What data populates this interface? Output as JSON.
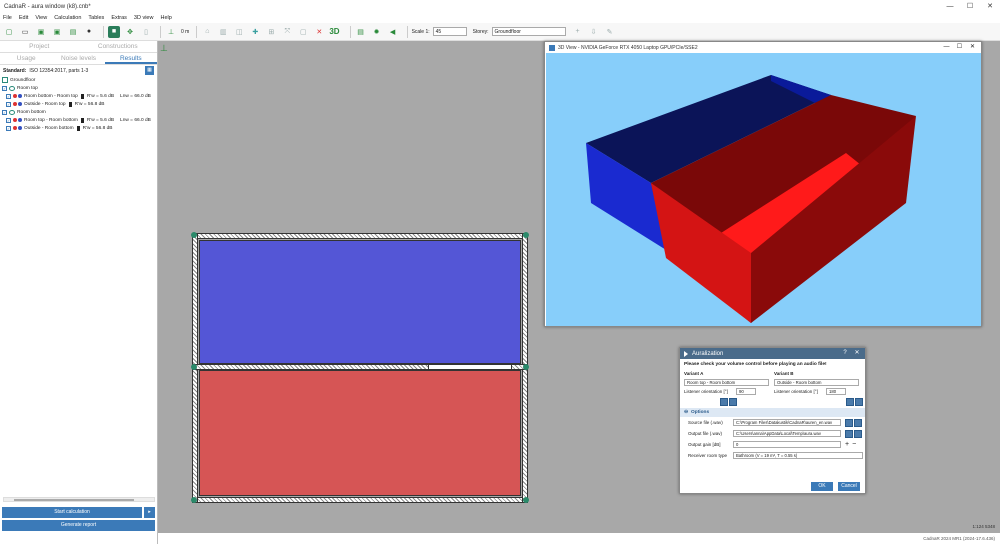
{
  "window": {
    "title": "CadnaR - aura window (k8).cnb*",
    "controls": [
      "—",
      "☐",
      "✕"
    ]
  },
  "menu": [
    "File",
    "Edit",
    "View",
    "Calculation",
    "Tables",
    "Extras",
    "3D view",
    "Help"
  ],
  "toolbar": {
    "height_value": "0 m",
    "scale_label": "Scale 1:",
    "scale_value": "45",
    "storey_label": "Storey:",
    "storey_value": "Groundfloor",
    "view3d_label": "3D"
  },
  "left_panel": {
    "tabs_top": [
      "Project",
      "Constructions"
    ],
    "tabs_bottom": [
      "Usage",
      "Noise levels",
      "Results"
    ],
    "standard_label": "Standard:",
    "standard_value": "ISO 12354:2017, parts 1-3",
    "tree": {
      "floor": "Groundfloor",
      "rooms": [
        {
          "name": "Room top",
          "rows": [
            {
              "text": "Room bottom - Room top",
              "metric_a": "R'w = 5.6 dB",
              "metric_b": "Lnw = 66.0 dB"
            },
            {
              "text": "Outside - Room top",
              "metric_a": "R'w = 56.8 dB"
            }
          ]
        },
        {
          "name": "Room bottom",
          "rows": [
            {
              "text": "Room top - Room bottom",
              "metric_a": "R'w = 5.6 dB",
              "metric_b": "Lnw = 66.0 dB"
            },
            {
              "text": "Outside - Room bottom",
              "metric_a": "R'w = 56.8 dB"
            }
          ]
        }
      ]
    },
    "start_button": "Start calculation",
    "report_button": "Generate report"
  },
  "status": {
    "scale": "1:124 5348"
  },
  "view3d": {
    "title": "3D View - NVIDIA GeForce RTX 4050 Laptop GPU/PCIe/SSE2",
    "bg": "#87CEFA",
    "colors": {
      "blue": "#1a24b8",
      "blue_dark": "#0a1060",
      "red": "#d41414",
      "red_dark": "#6a0a0a"
    }
  },
  "auralization": {
    "title": "Auralization",
    "warning": "Please check your volume control before playing an audio file!",
    "variant_a_label": "Variant A",
    "variant_b_label": "Variant B",
    "variant_a_value": "Room top - Room bottom",
    "variant_b_value": "Outside - Room bottom",
    "listener_label": "Listener orientation [°]",
    "listener_a": "90",
    "listener_b": "180",
    "options_label": "Options",
    "source_label": "Source file (.wav)",
    "source_value": "C:\\Program Files\\Datakustik\\CadnaR\\auren_en.wav",
    "output_label": "Output file (.wav)",
    "output_value": "C:\\Users\\anna\\AppData\\Local\\Temp\\aura.wav",
    "gain_label": "Output gain [dB]",
    "gain_value": "0",
    "receiver_label": "Receiver room type",
    "receiver_value": "Bathroom (V = 19 m³, T = 0.55 s)",
    "ok": "OK",
    "cancel": "Cancel"
  },
  "footer": "CadnaR 2024 MR1 (2024-17.6.436)"
}
